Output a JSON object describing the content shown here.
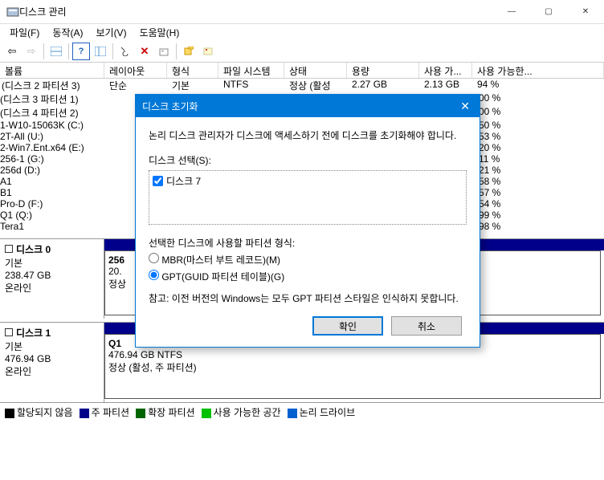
{
  "window": {
    "title": "디스크 관리"
  },
  "menu": {
    "file": "파일(F)",
    "action": "동작(A)",
    "view": "보기(V)",
    "help": "도움말(H)"
  },
  "columns": {
    "volume": "볼륨",
    "layout": "레이아웃",
    "type": "형식",
    "fs": "파일 시스템",
    "status": "상태",
    "capacity": "용량",
    "free": "사용 가...",
    "freelong": "사용 가능한..."
  },
  "row0": {
    "name": "(디스크 2 파티션 3)",
    "layout": "단순",
    "type": "기본",
    "fs": "NTFS",
    "status": "정상 (활성",
    "capacity": "2.27 GB",
    "free": "2.13 GB",
    "pct": "94 %"
  },
  "volumes": [
    {
      "name": "(디스크 3 파티션 1)",
      "pct": "00 %"
    },
    {
      "name": "(디스크 4 파티션 2)",
      "pct": "00 %"
    },
    {
      "name": "1-W10-15063K (C:)",
      "pct": "50 %"
    },
    {
      "name": "2T-All (U:)",
      "pct": "53 %"
    },
    {
      "name": "2-Win7.Ent.x64 (E:)",
      "pct": "20 %"
    },
    {
      "name": "256-1 (G:)",
      "pct": "11 %"
    },
    {
      "name": "256d (D:)",
      "pct": "21 %"
    },
    {
      "name": "A1",
      "pct": "58 %"
    },
    {
      "name": "B1",
      "pct": "57 %"
    },
    {
      "name": "Pro-D (F:)",
      "pct": "54 %"
    },
    {
      "name": "Q1 (Q:)",
      "pct": "99 %"
    },
    {
      "name": "Tera1",
      "pct": "98 %"
    }
  ],
  "disk0": {
    "name": "디스크 0",
    "type": "기본",
    "size": "238.47 GB",
    "status": "온라인",
    "part_name": "256",
    "part_size": "20.",
    "part_stat": "정상"
  },
  "disk1": {
    "name": "디스크 1",
    "type": "기본",
    "size": "476.94 GB",
    "status": "온라인",
    "part_name": "Q1",
    "part_size": "476.94 GB NTFS",
    "part_stat": "정상 (활성, 주 파티션)"
  },
  "legend": {
    "unalloc": "할당되지 않음",
    "primary": "주 파티션",
    "extended": "확장 파티션",
    "free": "사용 가능한 공간",
    "logical": "논리 드라이브"
  },
  "dialog": {
    "title": "디스크 초기화",
    "intro": "논리 디스크 관리자가 디스크에 액세스하기 전에 디스크를 초기화해야 합니다.",
    "select_label": "디스크 선택(S):",
    "disk_item": "디스크 7",
    "part_label": "선택한 디스크에 사용할 파티션 형식:",
    "mbr": "MBR(마스터 부트 레코드)(M)",
    "gpt": "GPT(GUID 파티션 테이블)(G)",
    "note": "참고: 이전 버전의 Windows는 모두 GPT 파티션 스타일은 인식하지 못합니다.",
    "ok": "확인",
    "cancel": "취소"
  }
}
